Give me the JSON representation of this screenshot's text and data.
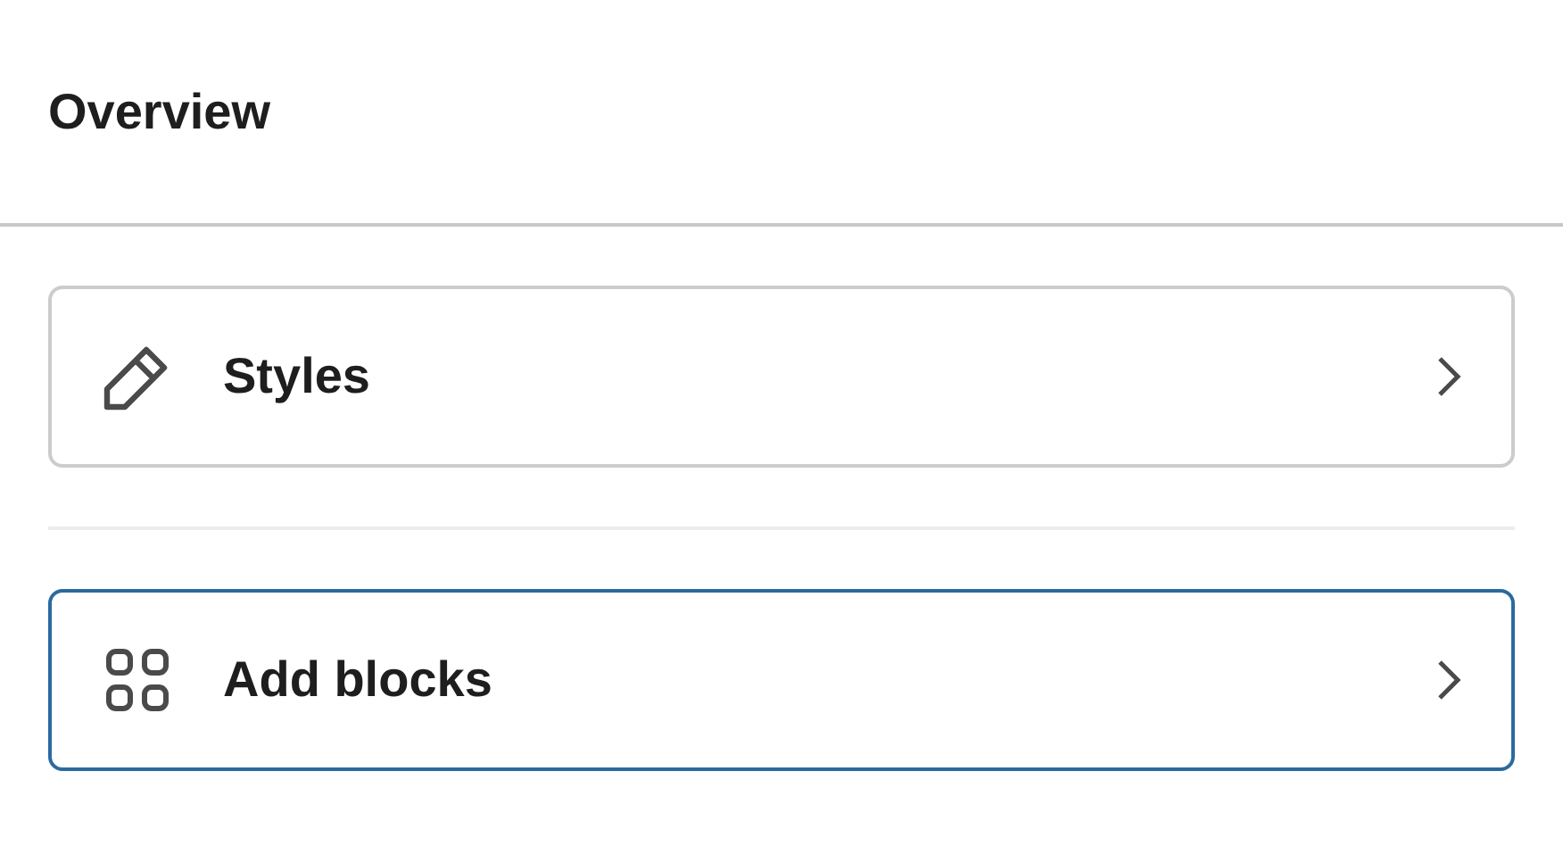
{
  "header": {
    "title": "Overview"
  },
  "items": [
    {
      "label": "Styles",
      "kind": "pencil",
      "hovered": false
    },
    {
      "label": "Add blocks",
      "kind": "grid",
      "hovered": true
    }
  ]
}
